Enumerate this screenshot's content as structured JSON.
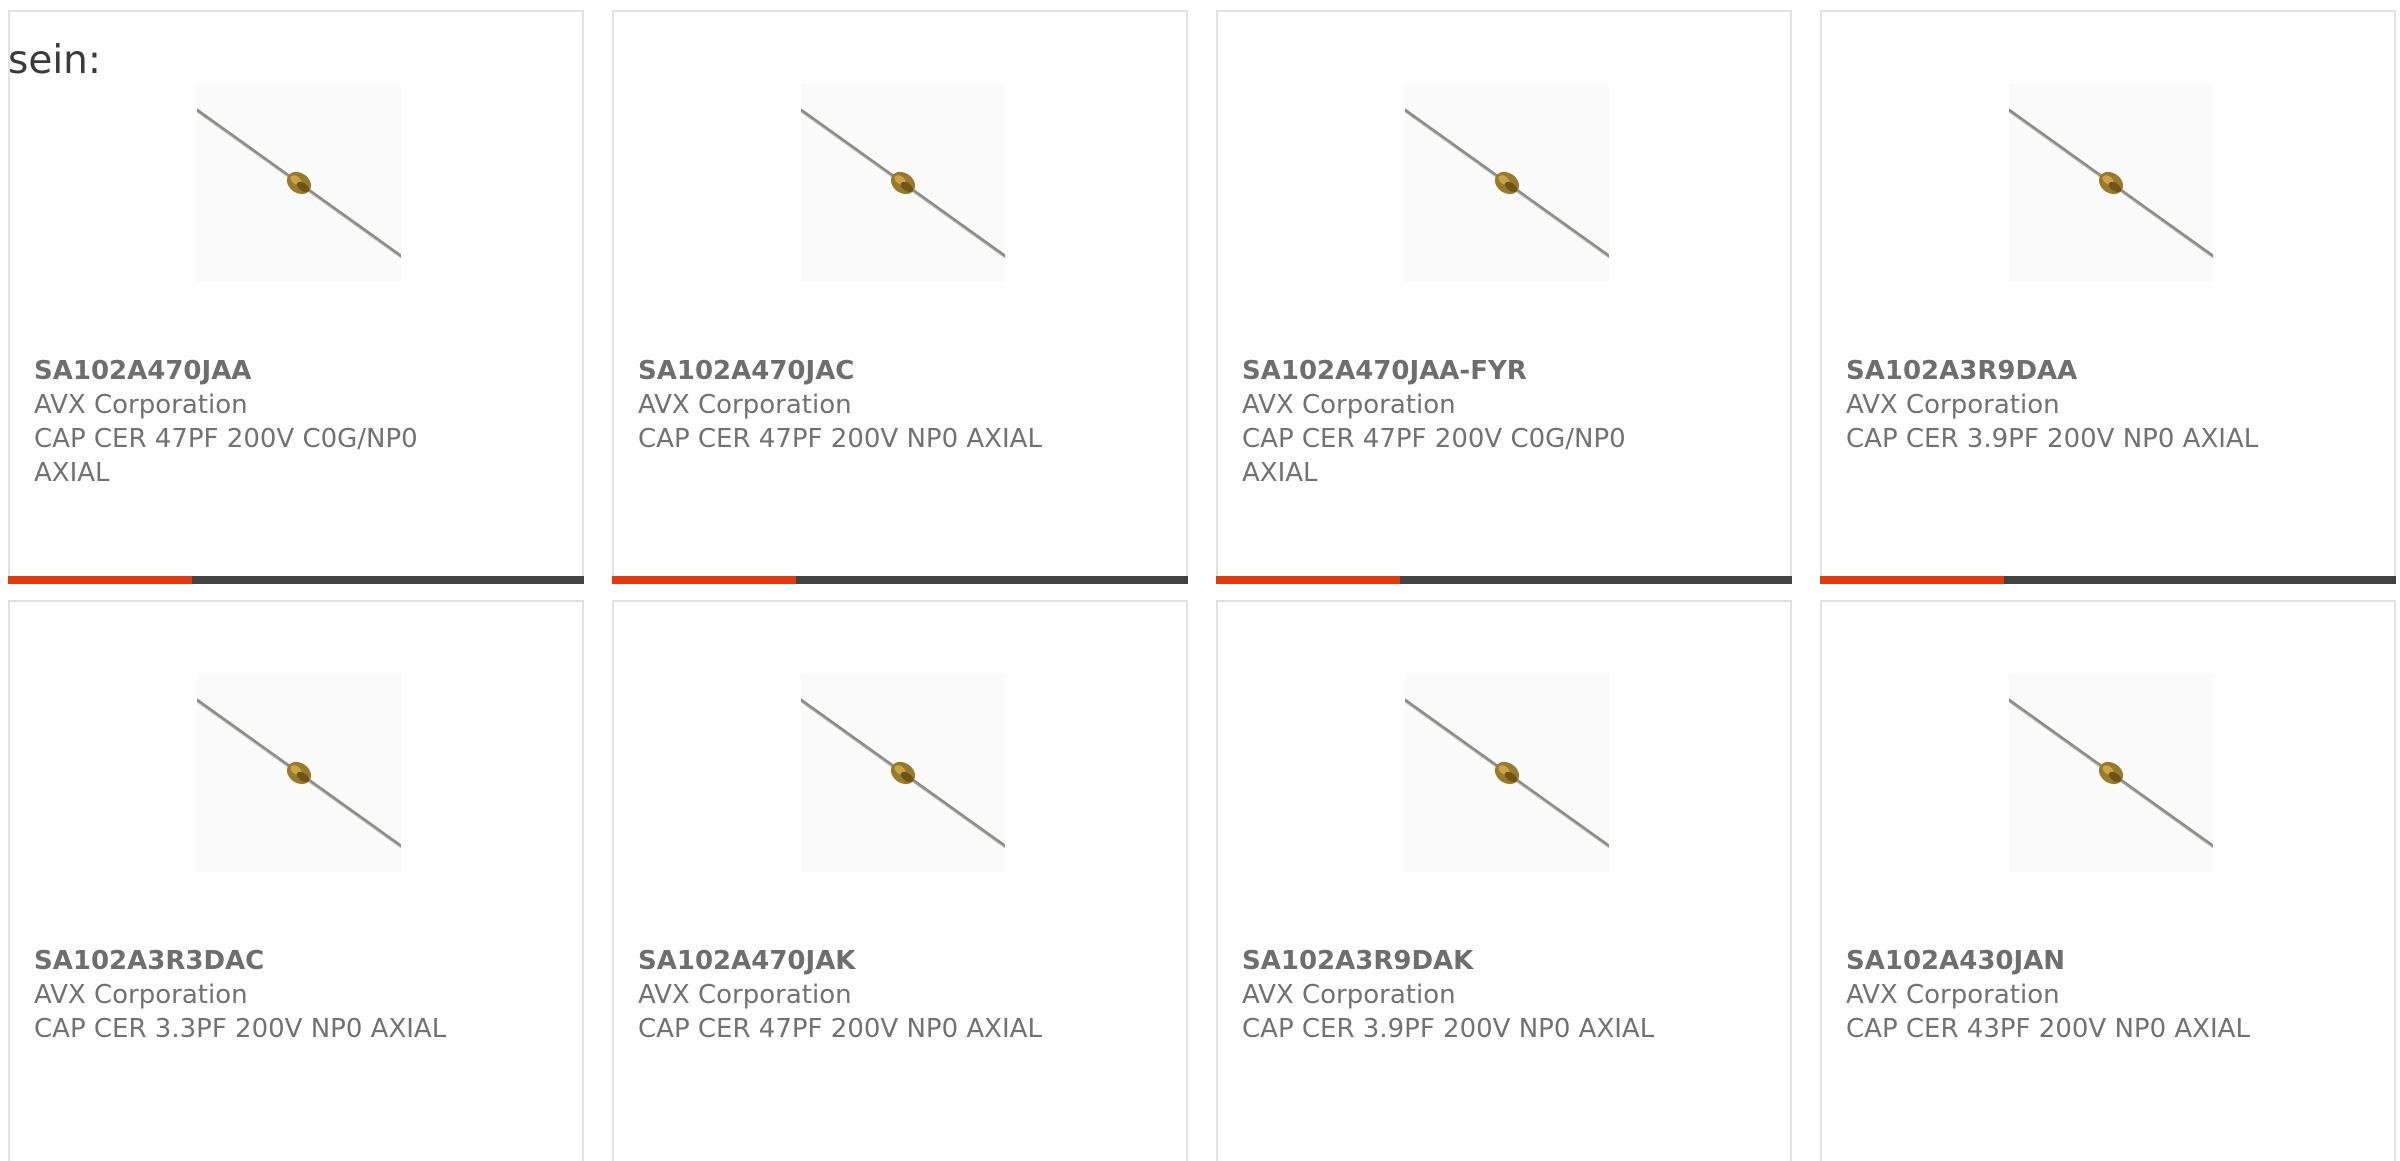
{
  "intro_text": "sein:",
  "colors": {
    "accent": "#e23a0c",
    "bar": "#424242",
    "border": "#e2e2e2",
    "text": "#727272"
  },
  "icon": "axial-capacitor-icon",
  "cards": [
    {
      "part": "SA102A470JAA",
      "manufacturer": "AVX Corporation",
      "description": "CAP CER 47PF 200V C0G/NP0 AXIAL",
      "progress": 0.32,
      "has_bar": true
    },
    {
      "part": "SA102A470JAC",
      "manufacturer": "AVX Corporation",
      "description": "CAP CER 47PF 200V NP0 AXIAL",
      "progress": 0.32,
      "has_bar": true
    },
    {
      "part": "SA102A470JAA-FYR",
      "manufacturer": "AVX Corporation",
      "description": "CAP CER 47PF 200V C0G/NP0 AXIAL",
      "progress": 0.32,
      "has_bar": true
    },
    {
      "part": "SA102A3R9DAA",
      "manufacturer": "AVX Corporation",
      "description": "CAP CER 3.9PF 200V NP0 AXIAL",
      "progress": 0.32,
      "has_bar": true
    },
    {
      "part": "SA102A3R3DAC",
      "manufacturer": "AVX Corporation",
      "description": "CAP CER 3.3PF 200V NP0 AXIAL",
      "has_bar": false
    },
    {
      "part": "SA102A470JAK",
      "manufacturer": "AVX Corporation",
      "description": "CAP CER 47PF 200V NP0 AXIAL",
      "has_bar": false
    },
    {
      "part": "SA102A3R9DAK",
      "manufacturer": "AVX Corporation",
      "description": "CAP CER 3.9PF 200V NP0 AXIAL",
      "has_bar": false
    },
    {
      "part": "SA102A430JAN",
      "manufacturer": "AVX Corporation",
      "description": "CAP CER 43PF 200V NP0 AXIAL",
      "has_bar": false
    }
  ]
}
